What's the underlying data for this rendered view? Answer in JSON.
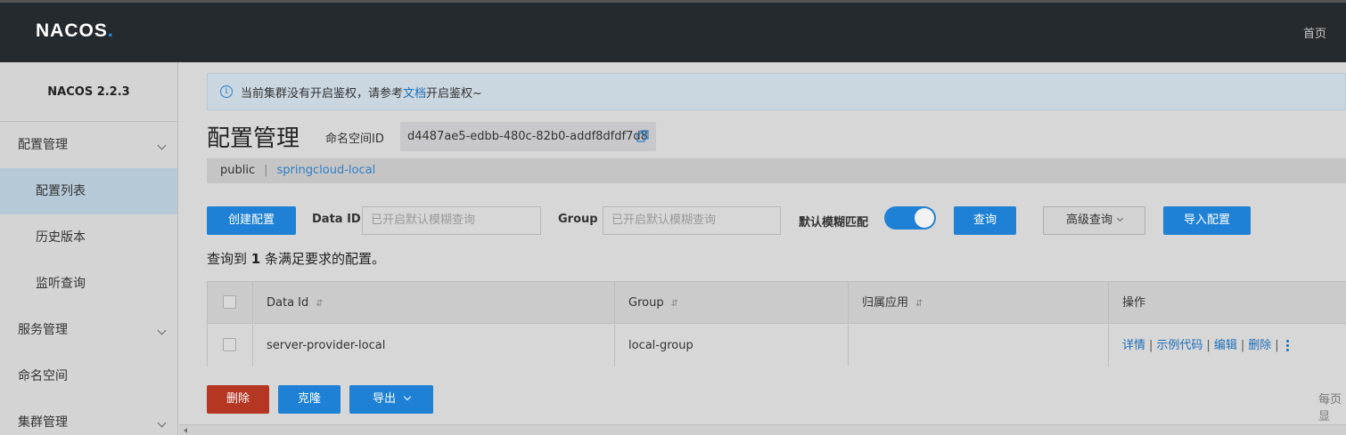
{
  "header": {
    "logo_text": "NACOS",
    "logo_dot": ".",
    "home_label": "首页"
  },
  "sidebar": {
    "version": "NACOS 2.2.3",
    "items": [
      {
        "label": "配置管理",
        "expandable": true
      },
      {
        "label": "配置列表",
        "sub": true,
        "active": true
      },
      {
        "label": "历史版本",
        "sub": true
      },
      {
        "label": "监听查询",
        "sub": true
      },
      {
        "label": "服务管理",
        "expandable": true
      },
      {
        "label": "命名空间"
      },
      {
        "label": "集群管理",
        "expandable": true
      }
    ]
  },
  "notice": {
    "icon": "info-icon",
    "text_before": "当前集群没有开启鉴权，请参考",
    "link": "文档",
    "text_after": "开启鉴权~"
  },
  "page": {
    "title": "配置管理",
    "namespace_label": "命名空间ID",
    "namespace_id": "d4487ae5-edbb-480c-82b0-addf8dfdf7d8"
  },
  "ns_tabs": {
    "items": [
      "public",
      "springcloud-local"
    ],
    "separator": "|",
    "active_index": 1
  },
  "toolbar": {
    "create_label": "创建配置",
    "dataid_label": "Data ID",
    "dataid_placeholder": "已开启默认模糊查询",
    "group_label": "Group",
    "group_placeholder": "已开启默认模糊查询",
    "fuzzy_label": "默认模糊匹配",
    "fuzzy_on": true,
    "query_label": "查询",
    "advanced_label": "高级查询",
    "import_label": "导入配置"
  },
  "result": {
    "prefix": "查询到",
    "count": "1",
    "suffix": "条满足要求的配置。"
  },
  "table": {
    "columns": [
      "Data Id",
      "Group",
      "归属应用",
      "操作"
    ],
    "sort_glyph": "⇵",
    "rows": [
      {
        "data_id": "server-provider-local",
        "group": "local-group",
        "app": "",
        "ops": [
          "详情",
          "示例代码",
          "编辑",
          "删除"
        ]
      }
    ],
    "op_separator": "|"
  },
  "bottom": {
    "delete_label": "删除",
    "clone_label": "克隆",
    "export_label": "导出",
    "per_page_label": "每页显"
  },
  "colors": {
    "primary": "#1f81d6",
    "danger": "#b53623",
    "header_bg": "#252a2f"
  }
}
